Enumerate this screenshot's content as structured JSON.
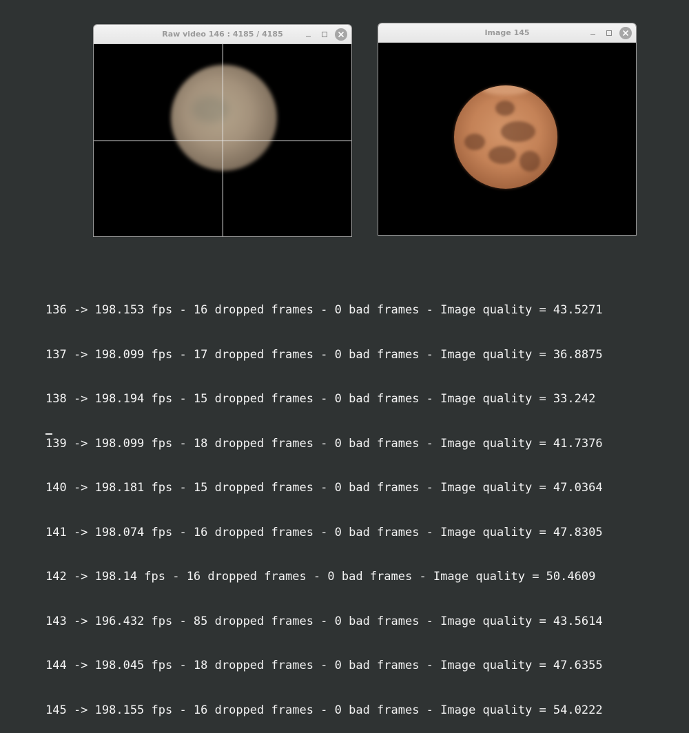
{
  "raw_window": {
    "title": "Raw video 146 :  4185 /  4185"
  },
  "image_window": {
    "title": "Image 145"
  },
  "icons": {
    "minimize": "minimize-icon",
    "maximize": "maximize-icon",
    "close": "close-icon"
  },
  "console": {
    "lines": [
      "136 -> 198.153 fps - 16 dropped frames - 0 bad frames - Image quality = 43.5271",
      "137 -> 198.099 fps - 17 dropped frames - 0 bad frames - Image quality = 36.8875",
      "138 -> 198.194 fps - 15 dropped frames - 0 bad frames - Image quality = 33.242",
      "139 -> 198.099 fps - 18 dropped frames - 0 bad frames - Image quality = 41.7376",
      "140 -> 198.181 fps - 15 dropped frames - 0 bad frames - Image quality = 47.0364",
      "141 -> 198.074 fps - 16 dropped frames - 0 bad frames - Image quality = 47.8305",
      "142 -> 198.14 fps - 16 dropped frames - 0 bad frames - Image quality = 50.4609",
      "143 -> 196.432 fps - 85 dropped frames - 0 bad frames - Image quality = 43.5614",
      "144 -> 198.045 fps - 18 dropped frames - 0 bad frames - Image quality = 47.6355",
      "145 -> 198.155 fps - 16 dropped frames - 0 bad frames - Image quality = 54.0222"
    ],
    "cursor": "_"
  },
  "colors": {
    "desktop_background": "#2f3333",
    "terminal_text": "#f2f2f2",
    "titlebar": "#ececec",
    "title_text": "#9a9a9a"
  }
}
